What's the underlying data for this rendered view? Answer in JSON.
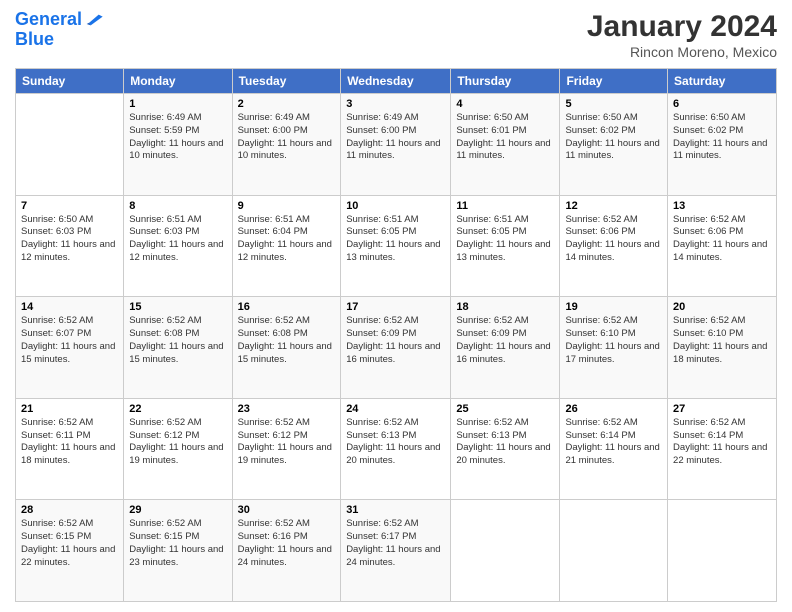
{
  "logo": {
    "line1": "General",
    "line2": "Blue"
  },
  "title": "January 2024",
  "subtitle": "Rincon Moreno, Mexico",
  "days_of_week": [
    "Sunday",
    "Monday",
    "Tuesday",
    "Wednesday",
    "Thursday",
    "Friday",
    "Saturday"
  ],
  "weeks": [
    [
      {
        "day": "",
        "sunrise": "",
        "sunset": "",
        "daylight": ""
      },
      {
        "day": "1",
        "sunrise": "Sunrise: 6:49 AM",
        "sunset": "Sunset: 5:59 PM",
        "daylight": "Daylight: 11 hours and 10 minutes."
      },
      {
        "day": "2",
        "sunrise": "Sunrise: 6:49 AM",
        "sunset": "Sunset: 6:00 PM",
        "daylight": "Daylight: 11 hours and 10 minutes."
      },
      {
        "day": "3",
        "sunrise": "Sunrise: 6:49 AM",
        "sunset": "Sunset: 6:00 PM",
        "daylight": "Daylight: 11 hours and 11 minutes."
      },
      {
        "day": "4",
        "sunrise": "Sunrise: 6:50 AM",
        "sunset": "Sunset: 6:01 PM",
        "daylight": "Daylight: 11 hours and 11 minutes."
      },
      {
        "day": "5",
        "sunrise": "Sunrise: 6:50 AM",
        "sunset": "Sunset: 6:02 PM",
        "daylight": "Daylight: 11 hours and 11 minutes."
      },
      {
        "day": "6",
        "sunrise": "Sunrise: 6:50 AM",
        "sunset": "Sunset: 6:02 PM",
        "daylight": "Daylight: 11 hours and 11 minutes."
      }
    ],
    [
      {
        "day": "7",
        "sunrise": "Sunrise: 6:50 AM",
        "sunset": "Sunset: 6:03 PM",
        "daylight": "Daylight: 11 hours and 12 minutes."
      },
      {
        "day": "8",
        "sunrise": "Sunrise: 6:51 AM",
        "sunset": "Sunset: 6:03 PM",
        "daylight": "Daylight: 11 hours and 12 minutes."
      },
      {
        "day": "9",
        "sunrise": "Sunrise: 6:51 AM",
        "sunset": "Sunset: 6:04 PM",
        "daylight": "Daylight: 11 hours and 12 minutes."
      },
      {
        "day": "10",
        "sunrise": "Sunrise: 6:51 AM",
        "sunset": "Sunset: 6:05 PM",
        "daylight": "Daylight: 11 hours and 13 minutes."
      },
      {
        "day": "11",
        "sunrise": "Sunrise: 6:51 AM",
        "sunset": "Sunset: 6:05 PM",
        "daylight": "Daylight: 11 hours and 13 minutes."
      },
      {
        "day": "12",
        "sunrise": "Sunrise: 6:52 AM",
        "sunset": "Sunset: 6:06 PM",
        "daylight": "Daylight: 11 hours and 14 minutes."
      },
      {
        "day": "13",
        "sunrise": "Sunrise: 6:52 AM",
        "sunset": "Sunset: 6:06 PM",
        "daylight": "Daylight: 11 hours and 14 minutes."
      }
    ],
    [
      {
        "day": "14",
        "sunrise": "Sunrise: 6:52 AM",
        "sunset": "Sunset: 6:07 PM",
        "daylight": "Daylight: 11 hours and 15 minutes."
      },
      {
        "day": "15",
        "sunrise": "Sunrise: 6:52 AM",
        "sunset": "Sunset: 6:08 PM",
        "daylight": "Daylight: 11 hours and 15 minutes."
      },
      {
        "day": "16",
        "sunrise": "Sunrise: 6:52 AM",
        "sunset": "Sunset: 6:08 PM",
        "daylight": "Daylight: 11 hours and 15 minutes."
      },
      {
        "day": "17",
        "sunrise": "Sunrise: 6:52 AM",
        "sunset": "Sunset: 6:09 PM",
        "daylight": "Daylight: 11 hours and 16 minutes."
      },
      {
        "day": "18",
        "sunrise": "Sunrise: 6:52 AM",
        "sunset": "Sunset: 6:09 PM",
        "daylight": "Daylight: 11 hours and 16 minutes."
      },
      {
        "day": "19",
        "sunrise": "Sunrise: 6:52 AM",
        "sunset": "Sunset: 6:10 PM",
        "daylight": "Daylight: 11 hours and 17 minutes."
      },
      {
        "day": "20",
        "sunrise": "Sunrise: 6:52 AM",
        "sunset": "Sunset: 6:10 PM",
        "daylight": "Daylight: 11 hours and 18 minutes."
      }
    ],
    [
      {
        "day": "21",
        "sunrise": "Sunrise: 6:52 AM",
        "sunset": "Sunset: 6:11 PM",
        "daylight": "Daylight: 11 hours and 18 minutes."
      },
      {
        "day": "22",
        "sunrise": "Sunrise: 6:52 AM",
        "sunset": "Sunset: 6:12 PM",
        "daylight": "Daylight: 11 hours and 19 minutes."
      },
      {
        "day": "23",
        "sunrise": "Sunrise: 6:52 AM",
        "sunset": "Sunset: 6:12 PM",
        "daylight": "Daylight: 11 hours and 19 minutes."
      },
      {
        "day": "24",
        "sunrise": "Sunrise: 6:52 AM",
        "sunset": "Sunset: 6:13 PM",
        "daylight": "Daylight: 11 hours and 20 minutes."
      },
      {
        "day": "25",
        "sunrise": "Sunrise: 6:52 AM",
        "sunset": "Sunset: 6:13 PM",
        "daylight": "Daylight: 11 hours and 20 minutes."
      },
      {
        "day": "26",
        "sunrise": "Sunrise: 6:52 AM",
        "sunset": "Sunset: 6:14 PM",
        "daylight": "Daylight: 11 hours and 21 minutes."
      },
      {
        "day": "27",
        "sunrise": "Sunrise: 6:52 AM",
        "sunset": "Sunset: 6:14 PM",
        "daylight": "Daylight: 11 hours and 22 minutes."
      }
    ],
    [
      {
        "day": "28",
        "sunrise": "Sunrise: 6:52 AM",
        "sunset": "Sunset: 6:15 PM",
        "daylight": "Daylight: 11 hours and 22 minutes."
      },
      {
        "day": "29",
        "sunrise": "Sunrise: 6:52 AM",
        "sunset": "Sunset: 6:15 PM",
        "daylight": "Daylight: 11 hours and 23 minutes."
      },
      {
        "day": "30",
        "sunrise": "Sunrise: 6:52 AM",
        "sunset": "Sunset: 6:16 PM",
        "daylight": "Daylight: 11 hours and 24 minutes."
      },
      {
        "day": "31",
        "sunrise": "Sunrise: 6:52 AM",
        "sunset": "Sunset: 6:17 PM",
        "daylight": "Daylight: 11 hours and 24 minutes."
      },
      {
        "day": "",
        "sunrise": "",
        "sunset": "",
        "daylight": ""
      },
      {
        "day": "",
        "sunrise": "",
        "sunset": "",
        "daylight": ""
      },
      {
        "day": "",
        "sunrise": "",
        "sunset": "",
        "daylight": ""
      }
    ]
  ]
}
